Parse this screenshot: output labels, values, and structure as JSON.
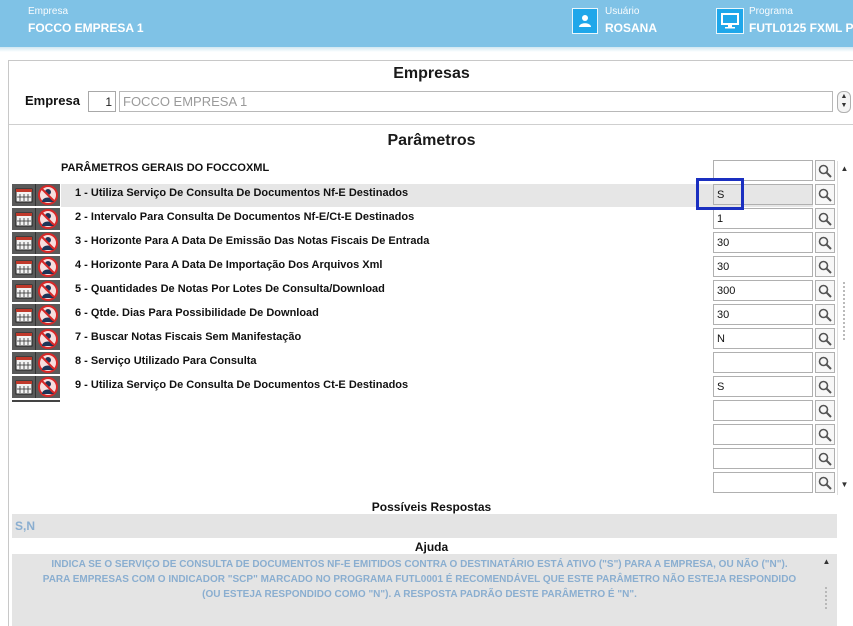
{
  "header": {
    "empresa_caption": "Empresa",
    "empresa_value": "FOCCO EMPRESA 1",
    "usuario_caption": "Usuário",
    "usuario_value": "ROSANA",
    "programa_caption": "Programa",
    "programa_value": "FUTL0125 FXML P",
    "accent_color": "#7fc2e6"
  },
  "empresas": {
    "title": "Empresas",
    "label": "Empresa",
    "code": "1",
    "name": "FOCCO EMPRESA 1"
  },
  "parametros": {
    "title": "Parâmetros",
    "group_title": "PARÂMETROS GERAIS DO FOCCOXML",
    "rows": [
      {
        "label": "1 - Utiliza Serviço De Consulta De Documentos Nf-E Destinados",
        "value": "S"
      },
      {
        "label": "2 - Intervalo Para Consulta De Documentos Nf-E/Ct-E Destinados",
        "value": "1"
      },
      {
        "label": "3 - Horizonte Para A Data De Emissão Das Notas Fiscais De Entrada",
        "value": "30"
      },
      {
        "label": "4 - Horizonte Para A Data De Importação Dos Arquivos Xml",
        "value": "30"
      },
      {
        "label": "5 - Quantidades De Notas Por Lotes De Consulta/Download",
        "value": "300"
      },
      {
        "label": "6 - Qtde. Dias Para Possibilidade De Download",
        "value": "30"
      },
      {
        "label": "7 - Buscar Notas Fiscais Sem Manifestação",
        "value": "N"
      },
      {
        "label": "8 - Serviço Utilizado Para Consulta",
        "value": ""
      },
      {
        "label": "9 - Utiliza Serviço De Consulta De Documentos Ct-E Destinados",
        "value": "S"
      }
    ]
  },
  "respostas": {
    "title": "Possíveis Respostas",
    "value": "S,N"
  },
  "ajuda": {
    "title": "Ajuda",
    "line1": "INDICA SE O SERVIÇO DE CONSULTA DE DOCUMENTOS NF-E EMITIDOS CONTRA O DESTINATÁRIO ESTÁ ATIVO (\"S\") PARA A EMPRESA, OU NÃO (\"N\").",
    "line2": "PARA EMPRESAS COM O INDICADOR \"SCP\" MARCADO NO PROGRAMA FUTL0001 É RECOMENDÁVEL QUE ESTE PARÂMETRO NÃO ESTEJA RESPONDIDO",
    "line3": "(OU ESTEJA RESPONDIDO COMO \"N\"). A RESPOSTA PADRÃO DESTE PARÂMETRO É \"N\"."
  },
  "icons": {
    "user": "user-icon",
    "program": "monitor-icon",
    "calendar": "calendar-icon",
    "person_blocked": "person-blocked-icon",
    "lookup": "magnifier-icon"
  }
}
